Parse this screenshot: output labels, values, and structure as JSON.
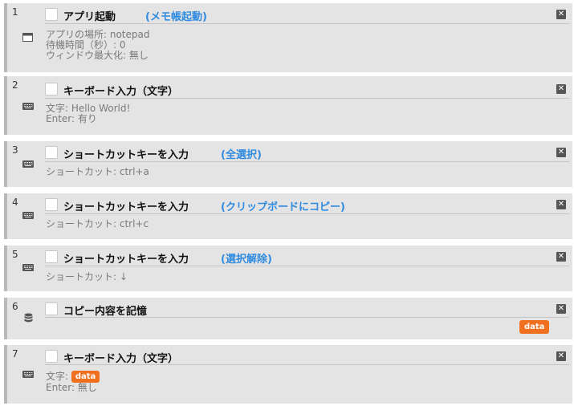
{
  "steps": [
    {
      "num": "1",
      "title": "アプリ起動",
      "note": "(メモ帳起動)",
      "params": [
        "アプリの場所: notepad",
        "待機時間（秒）: 0",
        "ウィンドウ最大化: 無し"
      ]
    },
    {
      "num": "2",
      "title": "キーボード入力（文字）",
      "params": [
        "文字: Hello World!",
        "Enter: 有り"
      ]
    },
    {
      "num": "3",
      "title": "ショートカットキーを入力",
      "note": "(全選択)",
      "params": [
        "ショートカット: ctrl+a"
      ]
    },
    {
      "num": "4",
      "title": "ショートカットキーを入力",
      "note": "(クリップボードにコピー)",
      "params": [
        "ショートカット: ctrl+c"
      ]
    },
    {
      "num": "5",
      "title": "ショートカットキーを入力",
      "note": "(選択解除)",
      "params": [
        "ショートカット: ↓"
      ]
    },
    {
      "num": "6",
      "title": "コピー内容を記憶",
      "badge": "data"
    },
    {
      "num": "7",
      "title": "キーボード入力（文字）",
      "param_label": "文字:",
      "param_badge": "data",
      "params_after": [
        "Enter: 無し"
      ]
    }
  ],
  "icons": {
    "app": "window-icon",
    "keyboard": "keyboard-icon",
    "storage": "database-icon",
    "close": "close-icon"
  },
  "colors": {
    "accent_note": "#2f8be0",
    "badge": "#f07020",
    "step_bg": "#e4e4e4"
  },
  "close_glyph": "✕"
}
